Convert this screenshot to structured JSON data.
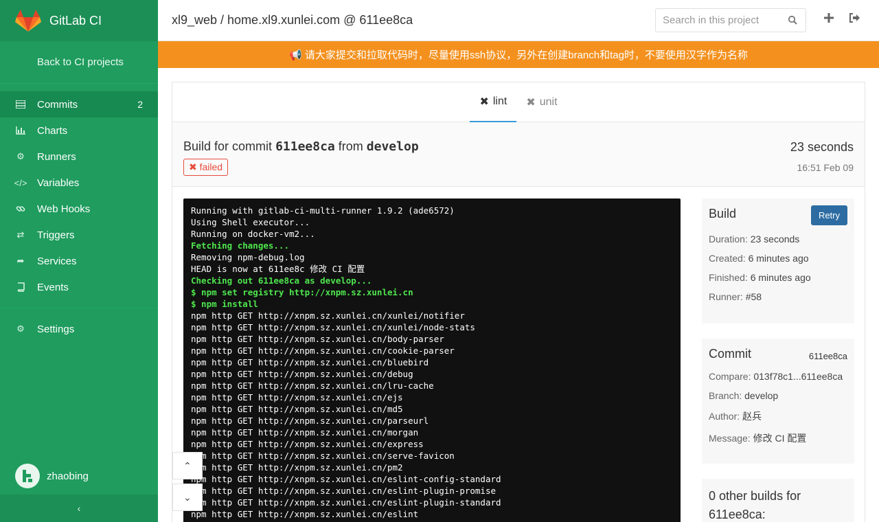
{
  "sidebar": {
    "brand": "GitLab CI",
    "back_link": "Back to CI projects",
    "items": [
      {
        "label": "Commits",
        "count": "2",
        "active": true
      },
      {
        "label": "Charts"
      },
      {
        "label": "Runners"
      },
      {
        "label": "Variables"
      },
      {
        "label": "Web Hooks"
      },
      {
        "label": "Triggers"
      },
      {
        "label": "Services"
      },
      {
        "label": "Events"
      }
    ],
    "settings": "Settings",
    "user": "zhaobing",
    "collapse_icon": "chevron-left-icon"
  },
  "header": {
    "title": "xl9_web / home.xl9.xunlei.com @ 611ee8ca",
    "search_placeholder": "Search in this project"
  },
  "banner": {
    "text": "📢 请大家提交和拉取代码时，尽量使用ssh协议，另外在创建branch和tag时，不要使用汉字作为名称"
  },
  "tabs": [
    {
      "label": "lint",
      "active": true
    },
    {
      "label": "unit",
      "active": false
    }
  ],
  "build": {
    "title_prefix": "Build for commit",
    "sha": "611ee8ca",
    "from": "from",
    "branch": "develop",
    "status": "failed",
    "duration": "23 seconds",
    "time": "16:51 Feb 09"
  },
  "terminal": {
    "lines": [
      {
        "t": "Running with gitlab-ci-multi-runner 1.9.2 (ade6572)",
        "g": false
      },
      {
        "t": "Using Shell executor...",
        "g": false
      },
      {
        "t": "Running on docker-vm2...",
        "g": false
      },
      {
        "t": "Fetching changes...",
        "g": true
      },
      {
        "t": "Removing npm-debug.log",
        "g": false
      },
      {
        "t": "HEAD is now at 611ee8c 修改 CI 配置",
        "g": false
      },
      {
        "t": "Checking out 611ee8ca as develop...",
        "g": true
      },
      {
        "t": "$ npm set registry http://xnpm.sz.xunlei.cn",
        "g": true
      },
      {
        "t": "$ npm install",
        "g": true
      },
      {
        "t": "npm http GET http://xnpm.sz.xunlei.cn/xunlei/notifier",
        "g": false
      },
      {
        "t": "npm http GET http://xnpm.sz.xunlei.cn/xunlei/node-stats",
        "g": false
      },
      {
        "t": "npm http GET http://xnpm.sz.xunlei.cn/body-parser",
        "g": false
      },
      {
        "t": "npm http GET http://xnpm.sz.xunlei.cn/cookie-parser",
        "g": false
      },
      {
        "t": "npm http GET http://xnpm.sz.xunlei.cn/bluebird",
        "g": false
      },
      {
        "t": "npm http GET http://xnpm.sz.xunlei.cn/debug",
        "g": false
      },
      {
        "t": "npm http GET http://xnpm.sz.xunlei.cn/lru-cache",
        "g": false
      },
      {
        "t": "npm http GET http://xnpm.sz.xunlei.cn/ejs",
        "g": false
      },
      {
        "t": "npm http GET http://xnpm.sz.xunlei.cn/md5",
        "g": false
      },
      {
        "t": "npm http GET http://xnpm.sz.xunlei.cn/parseurl",
        "g": false
      },
      {
        "t": "npm http GET http://xnpm.sz.xunlei.cn/morgan",
        "g": false
      },
      {
        "t": "npm http GET http://xnpm.sz.xunlei.cn/express",
        "g": false
      },
      {
        "t": "npm http GET http://xnpm.sz.xunlei.cn/serve-favicon",
        "g": false
      },
      {
        "t": "npm http GET http://xnpm.sz.xunlei.cn/pm2",
        "g": false
      },
      {
        "t": "npm http GET http://xnpm.sz.xunlei.cn/eslint-config-standard",
        "g": false
      },
      {
        "t": "npm http GET http://xnpm.sz.xunlei.cn/eslint-plugin-promise",
        "g": false
      },
      {
        "t": "npm http GET http://xnpm.sz.xunlei.cn/eslint-plugin-standard",
        "g": false
      },
      {
        "t": "npm http GET http://xnpm.sz.xunlei.cn/eslint",
        "g": false
      }
    ]
  },
  "build_panel": {
    "title": "Build",
    "retry": "Retry",
    "duration_k": "Duration:",
    "duration_v": "23 seconds",
    "created_k": "Created:",
    "created_v": "6 minutes ago",
    "finished_k": "Finished:",
    "finished_v": "6 minutes ago",
    "runner_k": "Runner:",
    "runner_v": "#58"
  },
  "commit_panel": {
    "title": "Commit",
    "sha": "611ee8ca",
    "compare_k": "Compare:",
    "compare_v": "013f78c1...611ee8ca",
    "branch_k": "Branch:",
    "branch_v": "develop",
    "author_k": "Author:",
    "author_v": "赵兵",
    "message_k": "Message:",
    "message_v": "修改 CI 配置"
  },
  "other_builds": {
    "title": "0 other builds for 611ee8ca:"
  },
  "colors": {
    "sidebar": "#1f9c5e",
    "banner": "#f4911e",
    "failed": "#e74c3c",
    "retry": "#2d6ca2",
    "terminal_green": "#4ee64e"
  }
}
